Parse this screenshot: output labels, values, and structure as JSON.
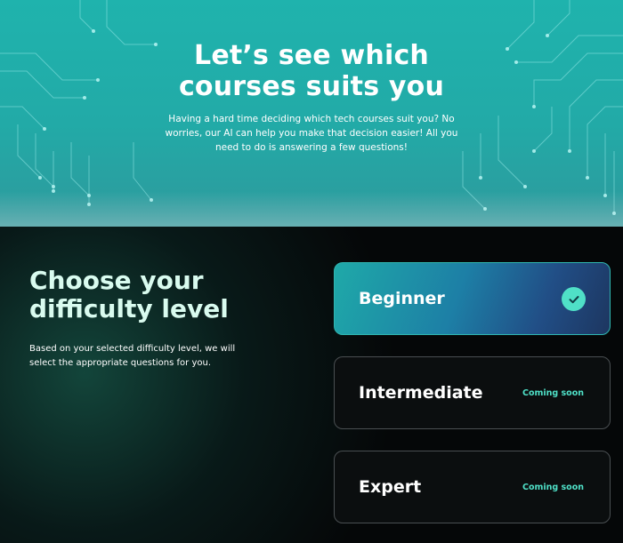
{
  "hero": {
    "title_line1": "Let’s see which",
    "title_line2": "courses suits you",
    "description": "Having a hard time deciding which tech courses suit you? No worries, our AI can help you make that decision easier! All you need to do is answering a few questions!"
  },
  "difficulty": {
    "title_line1": "Choose your",
    "title_line2": "difficulty level",
    "description": "Based on your selected difficulty level, we will select the appropriate questions for you.",
    "options": [
      {
        "label": "Beginner",
        "selected": true
      },
      {
        "label": "Intermediate",
        "status": "Coming soon"
      },
      {
        "label": "Expert",
        "status": "Coming soon"
      }
    ]
  },
  "colors": {
    "hero_teal": "#1fb3ad",
    "accent_mint": "#4fe0c7",
    "page_bg": "#050708",
    "title_tint": "#d9fbef"
  },
  "icons": {
    "selected_check": "check-circle-icon",
    "hero_decoration": "circuit-pattern"
  }
}
